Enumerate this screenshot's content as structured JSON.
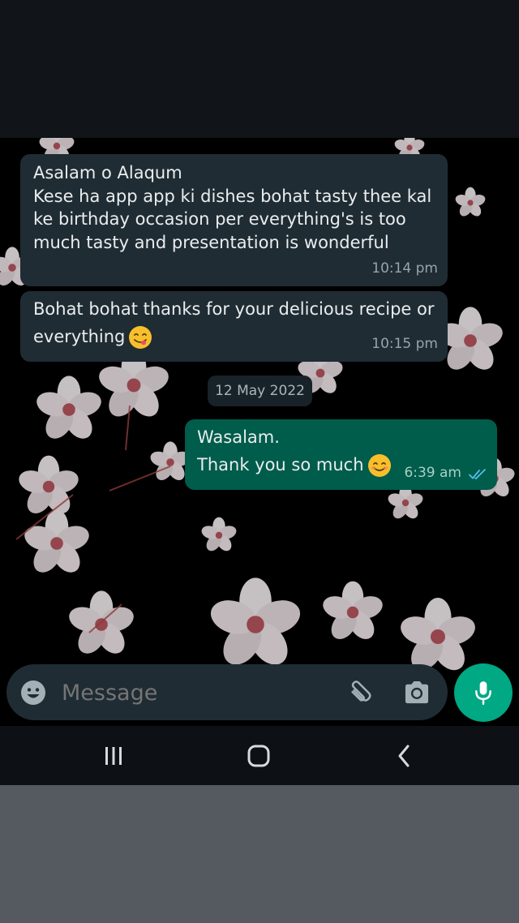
{
  "messages": [
    {
      "direction": "incoming",
      "text": "Asalam o Alaqum\nKese ha app app ki dishes bohat tasty thee kal\nke birthday occasion per everything's is too\nmuch tasty and presentation is wonderful",
      "time": "10:14 pm"
    },
    {
      "direction": "incoming",
      "text_line1": "Bohat bohat thanks for your delicious recipe or",
      "text_line2": "everything",
      "emoji": "face-savoring-food",
      "time": "10:15 pm"
    },
    {
      "direction": "outgoing",
      "text_line1": "Wasalam.",
      "text_line2": "Thank you so much",
      "emoji": "smiling-face",
      "time": "6:39 am",
      "status": "read",
      "status_color": "#53bdeb"
    }
  ],
  "date_divider": "12 May 2022",
  "composer": {
    "placeholder": "Message",
    "icons": [
      "emoji-icon",
      "attach-icon",
      "camera-icon",
      "mic-icon"
    ],
    "accent": "#00a884"
  },
  "nav": {
    "icons": [
      "recents-icon",
      "home-icon",
      "back-icon"
    ]
  },
  "colors": {
    "incoming_bubble": "#202c33",
    "outgoing_bubble": "#005c4b",
    "background": "#000000"
  }
}
